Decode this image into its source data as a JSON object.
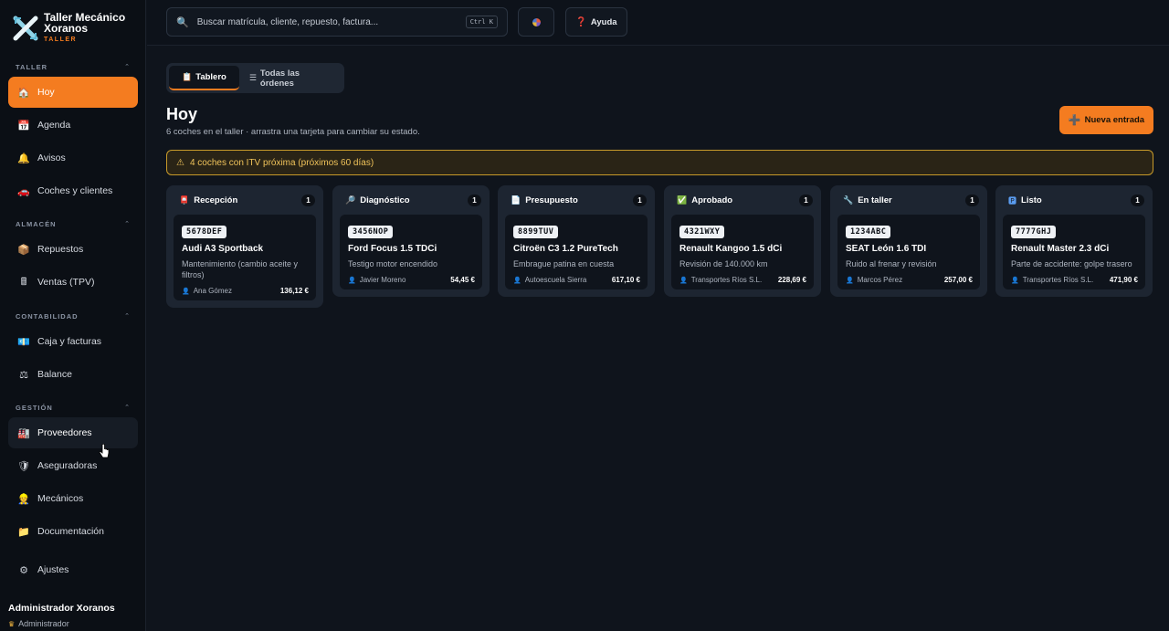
{
  "app": {
    "name": "Taller Mecánico Xoranos",
    "subtitle": "TALLER"
  },
  "sidebar": {
    "sections": [
      {
        "label": "TALLER",
        "items": [
          {
            "label": "Hoy",
            "icon": "house-icon"
          },
          {
            "label": "Agenda",
            "icon": "calendar-icon"
          },
          {
            "label": "Avisos",
            "icon": "bell-icon"
          },
          {
            "label": "Coches y clientes",
            "icon": "car-icon"
          }
        ]
      },
      {
        "label": "ALMACÉN",
        "items": [
          {
            "label": "Repuestos",
            "icon": "package-icon"
          },
          {
            "label": "Ventas (TPV)",
            "icon": "register-icon"
          }
        ]
      },
      {
        "label": "CONTABILIDAD",
        "items": [
          {
            "label": "Caja y facturas",
            "icon": "cash-icon"
          },
          {
            "label": "Balance",
            "icon": "scale-icon"
          }
        ]
      },
      {
        "label": "GESTIÓN",
        "items": [
          {
            "label": "Proveedores",
            "icon": "factory-icon"
          },
          {
            "label": "Aseguradoras",
            "icon": "shield-icon"
          },
          {
            "label": "Mecánicos",
            "icon": "mechanic-icon"
          },
          {
            "label": "Documentación",
            "icon": "folder-icon"
          }
        ]
      }
    ],
    "settings": {
      "label": "Ajustes",
      "icon": "gear-icon"
    },
    "user": {
      "name": "Administrador Xoranos",
      "role": "Administrador"
    }
  },
  "topbar": {
    "search": {
      "label": "Buscar matrícula, cliente, repuesto, factura...",
      "shortcut": "Ctrl K"
    },
    "help_label": "Ayuda"
  },
  "tabs": [
    {
      "label": "Tablero",
      "icon": "clipboard-icon",
      "active": true
    },
    {
      "label": "Todas las órdenes",
      "icon": "list-icon",
      "active": false
    }
  ],
  "page": {
    "title": "Hoy",
    "subtitle": "6 coches en el taller · arrastra una tarjeta para cambiar su estado.",
    "new_button": "Nueva entrada",
    "alert": "4 coches con ITV próxima (próximos 60 días)"
  },
  "board": {
    "columns": [
      {
        "name": "Recepción",
        "icon": "inbox-icon",
        "count": "1",
        "cards": [
          {
            "plate": "5678DEF",
            "car": "Audi A3 Sportback",
            "desc": "Mantenimiento (cambio aceite y filtros)",
            "client": "Ana Gómez",
            "price": "136,12 €"
          }
        ]
      },
      {
        "name": "Diagnóstico",
        "icon": "magnifier-icon",
        "count": "1",
        "cards": [
          {
            "plate": "3456NOP",
            "car": "Ford Focus 1.5 TDCi",
            "desc": "Testigo motor encendido",
            "client": "Javier Moreno",
            "price": "54,45 €"
          }
        ]
      },
      {
        "name": "Presupuesto",
        "icon": "document-icon",
        "count": "1",
        "cards": [
          {
            "plate": "8899TUV",
            "car": "Citroën C3 1.2 PureTech",
            "desc": "Embrague patina en cuesta",
            "client": "Autoescuela Sierra",
            "price": "617,10 €"
          }
        ]
      },
      {
        "name": "Aprobado",
        "icon": "check-icon",
        "count": "1",
        "cards": [
          {
            "plate": "4321WXY",
            "car": "Renault Kangoo 1.5 dCi",
            "desc": "Revisión de 140.000 km",
            "client": "Transportes Ríos S.L.",
            "price": "228,69 €"
          }
        ]
      },
      {
        "name": "En taller",
        "icon": "wrench-icon",
        "count": "1",
        "cards": [
          {
            "plate": "1234ABC",
            "car": "SEAT León 1.6 TDI",
            "desc": "Ruido al frenar y revisión",
            "client": "Marcos Pérez",
            "price": "257,00 €"
          }
        ]
      },
      {
        "name": "Listo",
        "icon": "parking-icon",
        "count": "1",
        "cards": [
          {
            "plate": "7777GHJ",
            "car": "Renault Master 2.3 dCi",
            "desc": "Parte de accidente: golpe trasero",
            "client": "Transportes Ríos S.L.",
            "price": "471,90 €"
          }
        ]
      }
    ]
  },
  "colors": {
    "accent": "#f47c20",
    "background": "#0f141c",
    "sidebar": "#0b0f15",
    "column": "#1d2531",
    "alert_border": "#c79a2a",
    "alert_text": "#f0c35a"
  }
}
